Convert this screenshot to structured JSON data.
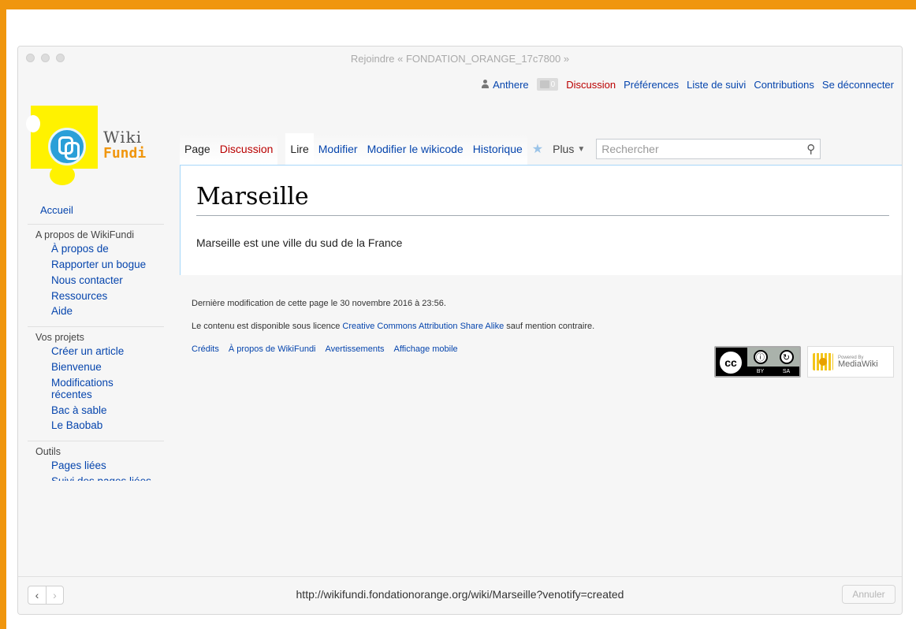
{
  "window": {
    "title": "Rejoindre « FONDATION_ORANGE_17c7800 »"
  },
  "personal_tools": {
    "username": "Anthere",
    "notification_count": "0",
    "items": [
      "Discussion",
      "Préférences",
      "Liste de suivi",
      "Contributions",
      "Se déconnecter"
    ]
  },
  "logo": {
    "line1": "Wiki",
    "line2": "Fundi"
  },
  "tabs": {
    "namespace": [
      "Page",
      "Discussion"
    ],
    "views": [
      "Lire",
      "Modifier",
      "Modifier le wikicode",
      "Historique"
    ],
    "more_label": "Plus",
    "search_placeholder": "Rechercher"
  },
  "article": {
    "title": "Marseille",
    "body": "Marseille est une ville du sud de la France"
  },
  "footer": {
    "last_modified": "Dernière modification de cette page le 30 novembre 2016 à 23:56.",
    "license_prefix": "Le contenu est disponible sous licence ",
    "license_link": "Creative Commons Attribution Share Alike",
    "license_suffix": " sauf mention contraire.",
    "links": [
      "Crédits",
      "À propos de WikiFundi",
      "Avertissements",
      "Affichage mobile"
    ],
    "cc_badge": {
      "logo": "cc",
      "by": "BY",
      "sa": "SA"
    },
    "mediawiki_badge": {
      "small": "Powered By",
      "big": "MediaWiki"
    }
  },
  "sidebar": {
    "home": "Accueil",
    "sections": [
      {
        "title": "A propos de WikiFundi",
        "items": [
          "À propos de",
          "Rapporter un bogue",
          "Nous contacter",
          "Ressources",
          "Aide"
        ]
      },
      {
        "title": "Vos projets",
        "items": [
          "Créer un article",
          "Bienvenue",
          "Modifications récentes",
          "Bac à sable",
          "Le Baobab"
        ]
      },
      {
        "title": "Outils",
        "items": [
          "Pages liées",
          "Suivi des pages liées"
        ]
      }
    ]
  },
  "bottombar": {
    "url": "http://wikifundi.fondationorange.org/wiki/Marseille?venotify=created",
    "cancel_label": "Annuler",
    "back_icon": "‹",
    "forward_icon": "›"
  },
  "colors": {
    "frame": "#f0960e",
    "link": "#0645ad",
    "red_link": "#ba0000"
  }
}
